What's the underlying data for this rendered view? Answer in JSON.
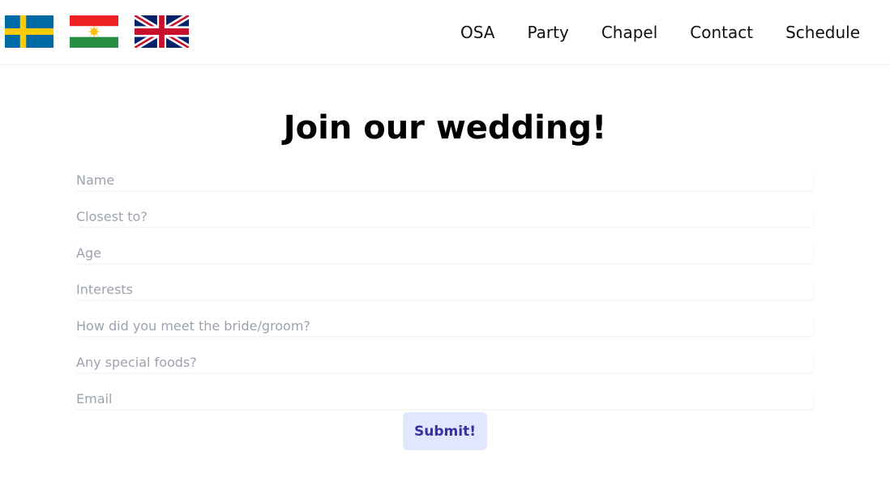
{
  "header": {
    "flags": [
      {
        "name": "sweden-flag",
        "colors": {
          "blue": "#006aa7",
          "yellow": "#fecc00"
        }
      },
      {
        "name": "kurdistan-flag",
        "colors": {
          "red": "#ed2024",
          "white": "#ffffff",
          "green": "#278e43",
          "sun": "#febd11"
        }
      },
      {
        "name": "uk-flag",
        "colors": {
          "blue": "#012169",
          "red": "#c8102e",
          "white": "#ffffff"
        }
      }
    ],
    "nav": [
      {
        "label": "OSA"
      },
      {
        "label": "Party"
      },
      {
        "label": "Chapel"
      },
      {
        "label": "Contact"
      },
      {
        "label": "Schedule"
      }
    ]
  },
  "main": {
    "title": "Join our wedding!",
    "fields": [
      {
        "placeholder": "Name",
        "value": ""
      },
      {
        "placeholder": "Closest to?",
        "value": ""
      },
      {
        "placeholder": "Age",
        "value": ""
      },
      {
        "placeholder": "Interests",
        "value": ""
      },
      {
        "placeholder": "How did you meet the bride/groom?",
        "value": ""
      },
      {
        "placeholder": "Any special foods?",
        "value": ""
      },
      {
        "placeholder": "Email",
        "value": ""
      }
    ],
    "submit_label": "Submit!"
  },
  "colors": {
    "submit_bg": "#e0e7ff",
    "submit_text": "#3730a3",
    "placeholder": "#9ca3af"
  }
}
